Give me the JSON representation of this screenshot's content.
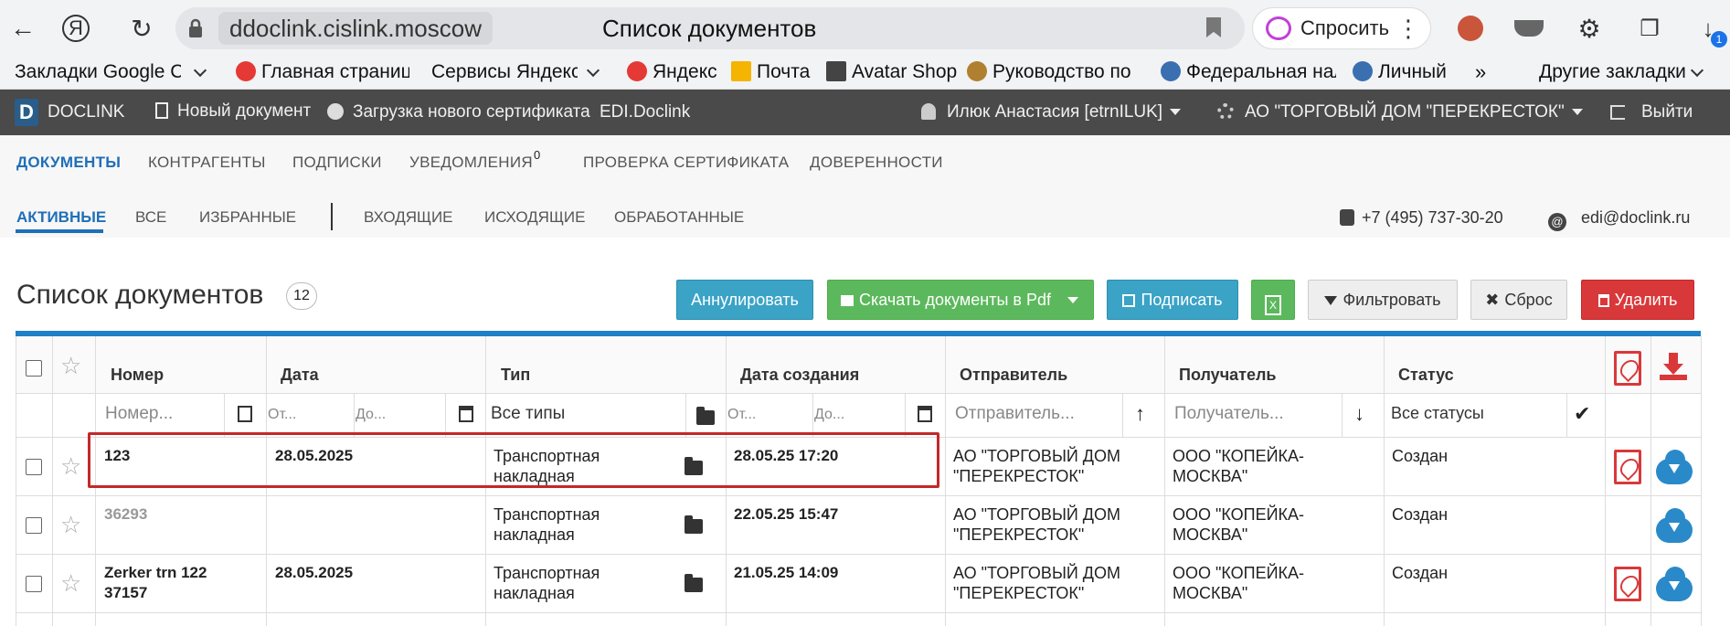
{
  "browser": {
    "host": "ddoclink.cislink.moscow",
    "tab_title": "Список документов",
    "ask_label": "Спросить",
    "download_badge": "1"
  },
  "bookmarks": [
    {
      "label": "Закладки Google Ch",
      "color": "#777"
    },
    {
      "label": "Главная страница",
      "color": "#e53935"
    },
    {
      "label": "Сервисы Яндекса",
      "color": "#777"
    },
    {
      "label": "Яндекс",
      "color": "#e53935"
    },
    {
      "label": "Почта",
      "color": "#f5b400"
    },
    {
      "label": "Avatar Shop",
      "color": "#444"
    },
    {
      "label": "Руководство по п",
      "color": "#b08030"
    },
    {
      "label": "Федеральная нал",
      "color": "#3a6fb0"
    },
    {
      "label": "Личный к",
      "color": "#3a6fb0"
    },
    {
      "label": "Другие закладки",
      "color": "#777"
    }
  ],
  "appnav": {
    "logo_letter": "D",
    "brand": "DOCLINK",
    "new_doc": "Новый документ",
    "upload_cert": "Загрузка нового сертификата",
    "edi": "EDI.Doclink",
    "user": "Илюк Анастасия [etrnILUK]",
    "org": "АО \"ТОРГОВЫЙ ДОМ \"ПЕРЕКРЕСТОК\"",
    "logout": "Выйти"
  },
  "tabs_main": {
    "documents": "ДОКУМЕНТЫ",
    "counterparties": "КОНТРАГЕНТЫ",
    "subscriptions": "ПОДПИСКИ",
    "notifications": "УВЕДОМЛЕНИЯ",
    "notifications_count": "0",
    "cert_check": "ПРОВЕРКА СЕРТИФИКАТА",
    "poa": "ДОВЕРЕННОСТИ"
  },
  "tabs_sub": {
    "active": "АКТИВНЫЕ",
    "all": "ВСЕ",
    "favorites": "ИЗБРАННЫЕ",
    "incoming": "ВХОДЯЩИЕ",
    "outgoing": "ИСХОДЯЩИЕ",
    "processed": "ОБРАБОТАННЫЕ"
  },
  "contacts": {
    "phone": "+7 (495) 737-30-20",
    "email": "edi@doclink.ru"
  },
  "page": {
    "title": "Список документов",
    "count": "12"
  },
  "toolbar": {
    "annul": "Аннулировать",
    "download_pdf": "Скачать документы в Pdf",
    "sign": "Подписать",
    "excel": "X",
    "filter": "Фильтровать",
    "reset": "Сброс",
    "delete": "Удалить"
  },
  "columns": {
    "number": "Номер",
    "date": "Дата",
    "type": "Тип",
    "created": "Дата создания",
    "sender": "Отправитель",
    "receiver": "Получатель",
    "status": "Статус"
  },
  "filters": {
    "number_ph": "Номер...",
    "date_from": "От...",
    "date_to": "До...",
    "type_value": "Все типы",
    "created_from": "От...",
    "created_to": "До...",
    "sender_ph": "Отправитель...",
    "receiver_ph": "Получатель...",
    "status_value": "Все статусы"
  },
  "rows": [
    {
      "number": "123",
      "number_line2": "",
      "date": "28.05.2025",
      "type1": "Транспортная",
      "type2": "накладная",
      "created": "28.05.25 17:20",
      "sender1": "АО \"ТОРГОВЫЙ ДОМ",
      "sender2": "\"ПЕРЕКРЕСТОК\"",
      "receiver1": "ООО \"КОПЕЙКА-",
      "receiver2": "МОСКВА\"",
      "status": "Создан"
    },
    {
      "number": "36293",
      "number_line2": "",
      "date": "",
      "type1": "Транспортная",
      "type2": "накладная",
      "created": "22.05.25 15:47",
      "sender1": "АО \"ТОРГОВЫЙ ДОМ",
      "sender2": "\"ПЕРЕКРЕСТОК\"",
      "receiver1": "ООО \"КОПЕЙКА-",
      "receiver2": "МОСКВА\"",
      "status": "Создан"
    },
    {
      "number": "Zerker trn 122",
      "number_line2": "37157",
      "date": "28.05.2025",
      "type1": "Транспортная",
      "type2": "накладная",
      "created": "21.05.25 14:09",
      "sender1": "АО \"ТОРГОВЫЙ ДОМ",
      "sender2": "\"ПЕРЕКРЕСТОК\"",
      "receiver1": "ООО \"КОПЕЙКА-",
      "receiver2": "МОСКВА\"",
      "status": "Создан"
    }
  ]
}
